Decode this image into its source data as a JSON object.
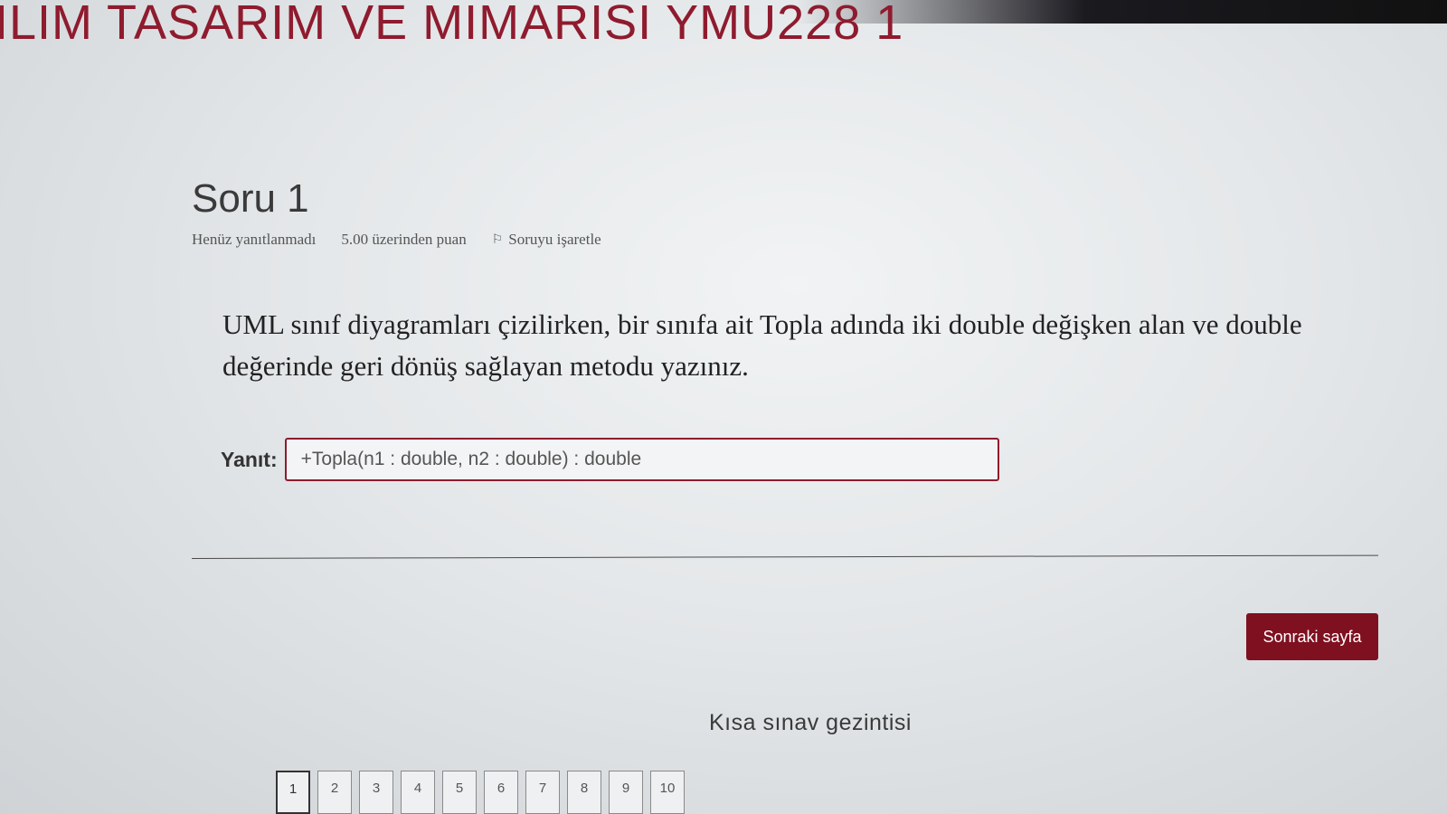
{
  "header": {
    "course_title": "ILIM TASARIM VE MIMARISI YMU228 1"
  },
  "question": {
    "number_label": "Soru 1",
    "status": "Henüz yanıtlanmadı",
    "points": "5.00 üzerinden puan",
    "flag_label": "Soruyu işaretle",
    "flag_icon": "flag-icon",
    "text": "UML sınıf diyagramları çizilirken, bir sınıfa ait Topla adında iki double değişken alan ve double değerinde geri dönüş sağlayan metodu yazınız.",
    "answer_label": "Yanıt:",
    "answer_value": "+Topla(n1 : double, n2 : double) : double"
  },
  "actions": {
    "next_page_label": "Sonraki sayfa"
  },
  "quiz_nav": {
    "title": "Kısa sınav gezintisi",
    "current": "1",
    "items": [
      "1",
      "2",
      "3",
      "4",
      "5",
      "6",
      "7",
      "8",
      "9",
      "10"
    ]
  },
  "colors": {
    "brand": "#8f1b2e",
    "button": "#7f1020"
  }
}
